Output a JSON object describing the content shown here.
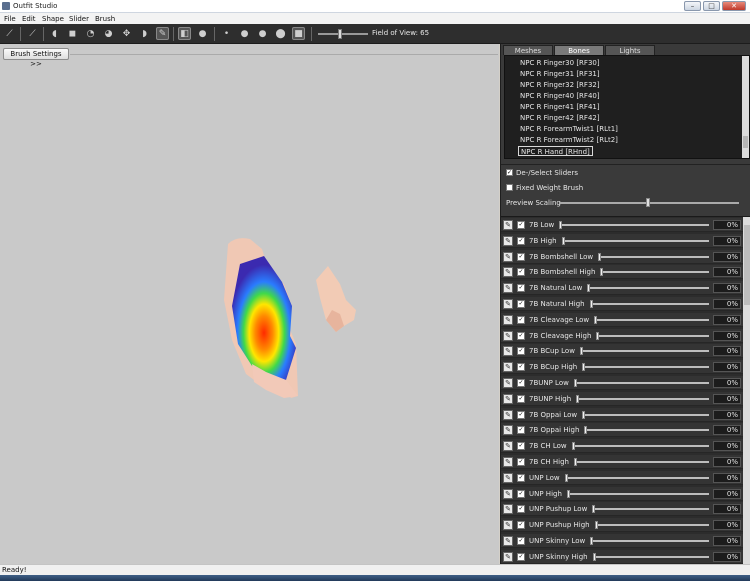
{
  "window": {
    "title": "Outfit Studio"
  },
  "menu": [
    "File",
    "Edit",
    "Shape",
    "Slider",
    "Brush"
  ],
  "toolbar": {
    "icons": [
      "select-icon",
      "transform-icon",
      "brush-icon",
      "mask-icon",
      "inflate-icon",
      "deflate-icon",
      "move-icon",
      "smooth-icon",
      "undo-icon",
      "weight-brush-icon",
      "mirror-icon",
      "color-icon",
      "brush-size-1-icon",
      "brush-size-2-icon",
      "brush-size-3-icon",
      "brush-size-4-icon",
      "cube-icon"
    ],
    "fov_label": "Field of View: 65",
    "fov_value": 65
  },
  "viewport": {
    "brush_settings_label": "Brush Settings >>"
  },
  "tabs": [
    {
      "label": "Meshes",
      "active": false
    },
    {
      "label": "Bones",
      "active": true
    },
    {
      "label": "Lights",
      "active": false
    }
  ],
  "bones": [
    {
      "label": "NPC R Finger30 [RF30]",
      "selected": false
    },
    {
      "label": "NPC R Finger31 [RF31]",
      "selected": false
    },
    {
      "label": "NPC R Finger32 [RF32]",
      "selected": false
    },
    {
      "label": "NPC R Finger40 [RF40]",
      "selected": false
    },
    {
      "label": "NPC R Finger41 [RF41]",
      "selected": false
    },
    {
      "label": "NPC R Finger42 [RF42]",
      "selected": false
    },
    {
      "label": "NPC R ForearmTwist1 [RLt1]",
      "selected": false
    },
    {
      "label": "NPC R ForearmTwist2 [RLt2]",
      "selected": false
    },
    {
      "label": "NPC R Hand [RHnd]",
      "selected": true
    }
  ],
  "options": {
    "deselect_sliders": {
      "label": "De-/Select Sliders",
      "checked": true
    },
    "fixed_weight_brush": {
      "label": "Fixed Weight Brush",
      "checked": false
    },
    "preview_scaling": {
      "label": "Preview Scaling",
      "value": 0.5
    }
  },
  "sliders": [
    {
      "name": "7B Low",
      "value": "0%",
      "pos": 0
    },
    {
      "name": "7B High",
      "value": "0%",
      "pos": 0
    },
    {
      "name": "7B Bombshell Low",
      "value": "0%",
      "pos": 0
    },
    {
      "name": "7B Bombshell High",
      "value": "0%",
      "pos": 0
    },
    {
      "name": "7B Natural Low",
      "value": "0%",
      "pos": 0
    },
    {
      "name": "7B Natural High",
      "value": "0%",
      "pos": 0
    },
    {
      "name": "7B Cleavage Low",
      "value": "0%",
      "pos": 0
    },
    {
      "name": "7B Cleavage High",
      "value": "0%",
      "pos": 0
    },
    {
      "name": "7B BCup Low",
      "value": "0%",
      "pos": 0
    },
    {
      "name": "7B BCup High",
      "value": "0%",
      "pos": 0
    },
    {
      "name": "7BUNP Low",
      "value": "0%",
      "pos": 0
    },
    {
      "name": "7BUNP High",
      "value": "0%",
      "pos": 0
    },
    {
      "name": "7B Oppai Low",
      "value": "0%",
      "pos": 0
    },
    {
      "name": "7B Oppai High",
      "value": "0%",
      "pos": 0
    },
    {
      "name": "7B CH Low",
      "value": "0%",
      "pos": 0
    },
    {
      "name": "7B CH High",
      "value": "0%",
      "pos": 0
    },
    {
      "name": "UNP Low",
      "value": "0%",
      "pos": 0
    },
    {
      "name": "UNP High",
      "value": "0%",
      "pos": 0
    },
    {
      "name": "UNP Pushup Low",
      "value": "0%",
      "pos": 0
    },
    {
      "name": "UNP Pushup High",
      "value": "0%",
      "pos": 0
    },
    {
      "name": "UNP Skinny Low",
      "value": "0%",
      "pos": 0
    },
    {
      "name": "UNP Skinny High",
      "value": "0%",
      "pos": 0
    }
  ],
  "status": {
    "text": "Ready!"
  },
  "colors": {
    "panel_bg": "#3a3a3a",
    "viewport_bg": "#c9c9c9",
    "toolbar_bg": "#2e2e2e"
  }
}
